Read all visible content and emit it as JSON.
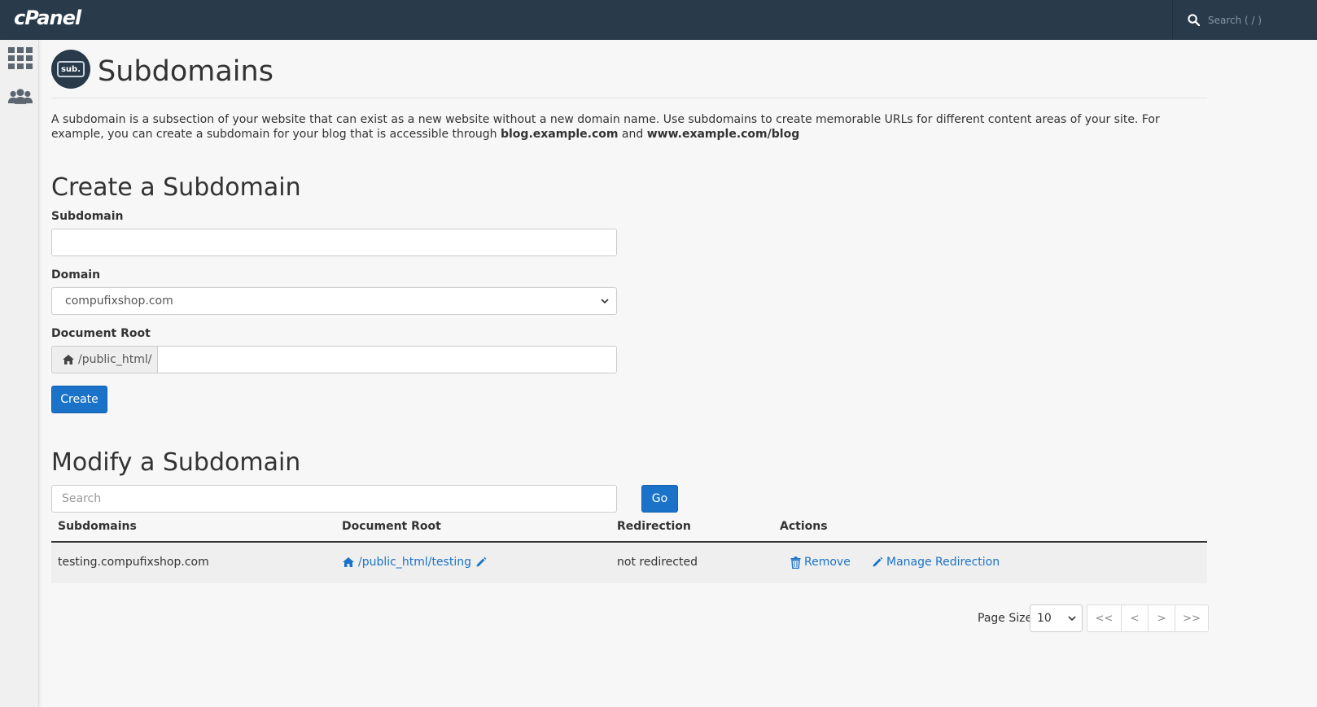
{
  "header": {
    "logo": "cPanel",
    "search_placeholder": "Search ( / )"
  },
  "page": {
    "icon_label": "sub.",
    "title": "Subdomains",
    "intro_text_1": "A subdomain is a subsection of your website that can exist as a new website without a new domain name. Use subdomains to create memorable URLs for different content areas of your site. For example, you can create a subdomain for your blog that is accessible through ",
    "intro_bold_1": "blog.example.com",
    "intro_text_2": " and ",
    "intro_bold_2": "www.example.com/blog"
  },
  "create": {
    "heading": "Create a Subdomain",
    "subdomain_label": "Subdomain",
    "subdomain_value": "",
    "domain_label": "Domain",
    "domain_value": "compufixshop.com",
    "docroot_label": "Document Root",
    "docroot_prefix": "/public_html/",
    "docroot_value": "",
    "create_button": "Create"
  },
  "modify": {
    "heading": "Modify a Subdomain",
    "search_placeholder": "Search",
    "go_button": "Go",
    "columns": {
      "subdomains": "Subdomains",
      "document_root": "Document Root",
      "redirection": "Redirection",
      "actions": "Actions"
    },
    "rows": [
      {
        "subdomain": "testing.compufixshop.com",
        "document_root": "/public_html/testing",
        "redirection": "not redirected",
        "remove_label": "Remove",
        "manage_label": "Manage Redirection"
      }
    ]
  },
  "pagination": {
    "page_size_label": "Page Size",
    "page_size_value": "10",
    "first": "<<",
    "prev": "<",
    "next": ">",
    "last": ">>"
  },
  "colors": {
    "topbar": "#293a4a",
    "primary": "#1a73c9"
  }
}
